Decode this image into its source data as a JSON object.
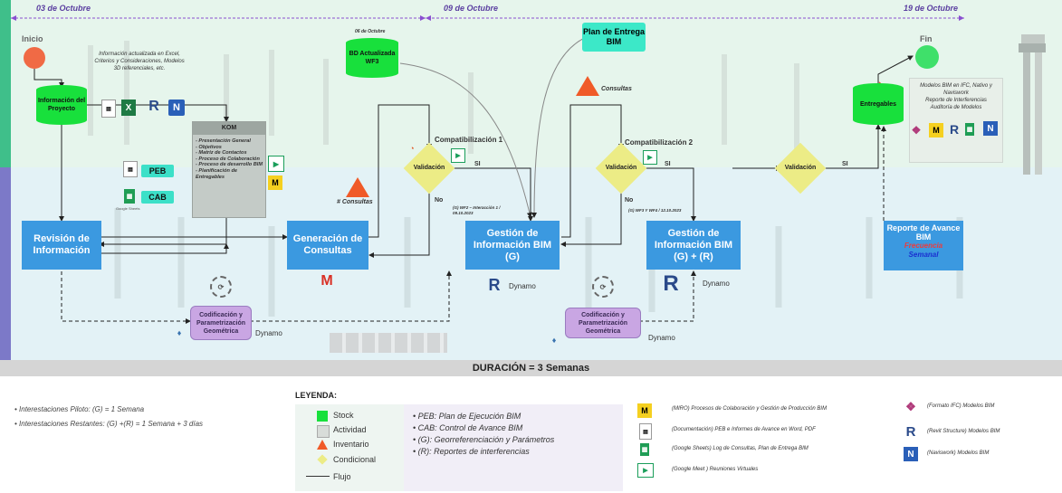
{
  "timeline": {
    "date1": "03 de Octubre",
    "date2": "09 de Octubre",
    "date3": "19 de Octubre"
  },
  "start_label": "Inicio",
  "end_label": "Fin",
  "note_info": "Información actualizada en Excel, Criterios y Consideraciones, Modelos 3D referenciales, etc.",
  "project_info": "Información del Proyecto",
  "kom": {
    "title": "KOM",
    "body": "- Presentación General\n- Objetivos\n- Matriz de Contactos\n- Proceso de Colaboración\n- Proceso de desarrollo BIM\n- Planificación de Entregables"
  },
  "peb_pill": "PEB",
  "cab_pill": "CAB",
  "google_sheets_caption": "Google Sheets",
  "bd_date": "06 de Octubre",
  "bd_label": "BD Actualizada WF3",
  "plan_label": "Plan de Entrega BIM",
  "consultas1": "# Consultas",
  "consultas2": "Consultas",
  "compat1": "Compatibilización 1",
  "compat2": "Compatibilización 2",
  "validacion": "Validación",
  "si": "SI",
  "no": "No",
  "revision": "Revisión de Información",
  "generacion": "Generación de Consultas",
  "gestion_g": "Gestión de Información BIM (G)",
  "gestion_gr": "Gestión de Información BIM (G) + (R)",
  "note_wf2": "(G) WF2 – Interacción 1 / 09.10.2023",
  "note_wf3": "(G) WF3 Y WF4 / 12.10.2023",
  "codificacion": "Codificación y Parametrización Geométrica",
  "dynamo": "Dynamo",
  "entregables": "Entregables",
  "note_final": "Modelos BIM en IFC, Nativo y Naviswork\nReporte de Interferencias\nAuditoría de Modelos",
  "reporte_title": "Reporte de Avance BIM",
  "reporte_freq": "Frecuencia",
  "reporte_sem": "Semanal",
  "duracion": "DURACIÓN = 3 Semanas",
  "footnotes": [
    "Interestaciones Piloto: (G) = 1 Semana",
    "Interestaciones Restantes: (G) +(R) = 1 Semana + 3 días"
  ],
  "legend": {
    "title": "LEYENDA:",
    "items": [
      "Stock",
      "Actividad",
      "Inventario",
      "Condicional",
      "Flujo"
    ],
    "abbr": [
      "PEB: Plan de Ejecución BIM",
      "CAB: Control de Avance BIM",
      "(G): Georreferenciación y Parámetros",
      "(R): Reportes de interferencias"
    ],
    "apps": [
      "(MIRO) Procesos de Colaboración y Gestión de Producción BIM",
      "(Documentación) PEB e Informes de Avance en Word, PDF",
      "(Google Sheets) Log de Consultas, Plan de Entrega BIM",
      "(Google Meet ) Reuniones Virtuales"
    ],
    "apps2": [
      "(Formato IFC) Modelos BIM",
      "(Revit Structure) Modelos BIM",
      "(Naviswork) Modelos BIM"
    ]
  },
  "colors": {
    "stock": "#18e03c",
    "activity": "#3b99e0",
    "inventory": "#f05a28",
    "conditional": "#ecec86",
    "purple": "#c9a6e3",
    "timeline": "#8a4fd0"
  }
}
